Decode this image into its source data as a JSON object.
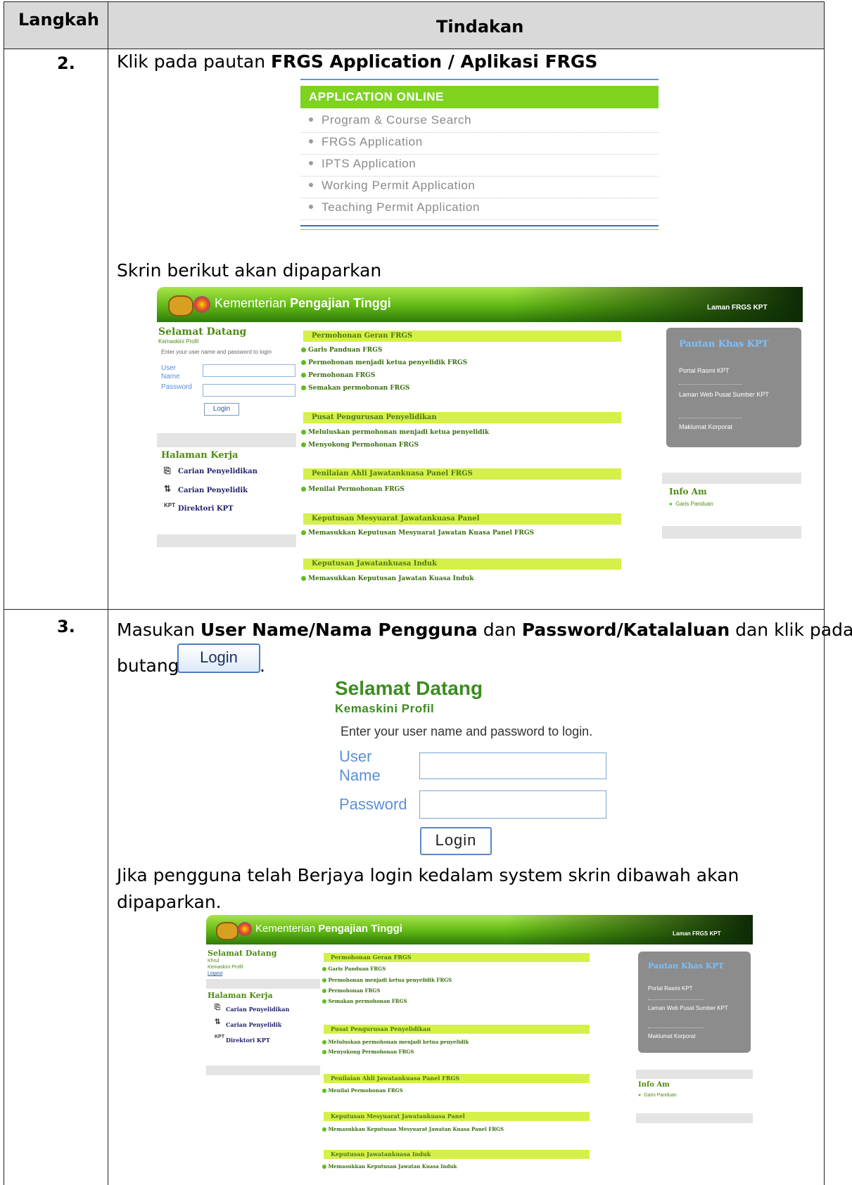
{
  "table": {
    "col_step": "Langkah",
    "col_action": "Tindakan"
  },
  "step2": {
    "number": "2.",
    "instruction_prefix": "Klik pada pautan ",
    "instruction_link": "FRGS Application / Aplikasi FRGS",
    "app_menu": {
      "header": "APPLICATION ONLINE",
      "items": [
        "Program & Course Search",
        "FRGS Application",
        "IPTS Application",
        "Working Permit Application",
        "Teaching Permit Application"
      ]
    },
    "caption": "Skrin berikut akan dipaparkan"
  },
  "portal1": {
    "title_light": "Kementerian ",
    "title_bold": "Pengajian Tinggi",
    "top_links": "Laman FRGS   KPT",
    "welcome": "Selamat Datang",
    "profile": "Kemaskini Profil",
    "hint": "Enter your user name and password to login",
    "user_label": "User Name",
    "password_label": "Password",
    "login_button": "Login",
    "work_title": "Halaman Kerja",
    "nav": [
      "Carian Penyelidikan",
      "Carian Penyelidik",
      "Direktori KPT"
    ],
    "sections": [
      {
        "title": "Permohonan Geran FRGS",
        "items": [
          "Garis Panduan FRGS",
          "Permohonan menjadi ketua penyelidik FRGS",
          "Permohonan FRGS",
          "Semakan permohonan FRGS"
        ]
      },
      {
        "title": "Pusat Pengurusan Penyelidikan",
        "items": [
          "Meluluskan permohonan menjadi ketua penyelidik",
          "Menyokong Permohonan FRGS"
        ]
      },
      {
        "title": "Penilaian Ahli Jawatankuasa Panel FRGS",
        "items": [
          "Menilai Permohonan FRGS"
        ]
      },
      {
        "title": "Keputusan Mesyuarat Jawatankuasa Panel",
        "items": [
          "Memasukkan Keputusan Mesyuarat Jawatan Kuasa Panel FRGS"
        ]
      },
      {
        "title": "Keputusan Jawatankuasa Induk",
        "items": [
          "Memasukkan Keputusan Jawatan Kuasa Induk"
        ]
      }
    ],
    "khas_title": "Pautan Khas KPT",
    "khas_links": [
      "Portal Rasmi KPT",
      "Laman Web Pusat Sumber KPT",
      "Maklumat Korporat"
    ],
    "info_title": "Info Am",
    "info_item": "Garis Panduan"
  },
  "step3": {
    "number": "3.",
    "line1_a": "Masukan ",
    "line1_b": "User Name/Nama Pengguna",
    "line1_c": " dan ",
    "line1_d": "Password/Katalaluan",
    "line1_e": " dan klik pada",
    "line2_a": "butang",
    "line2_b": ".",
    "inline_button": "Login",
    "login": {
      "title": "Selamat Datang",
      "subtitle": "Kemaskini Profil",
      "hint": "Enter your user name and password to login.",
      "user_line1": "User",
      "user_line2": "Name",
      "password_label": "Password",
      "button": "Login"
    },
    "after_line1": "Jika pengguna telah Berjaya login kedalam system skrin dibawah akan",
    "after_line2": "dipaparkan."
  },
  "portal2": {
    "title_light": "Kementerian ",
    "title_bold": "Pengajian Tinggi",
    "top_links": "Laman FRGS   KPT",
    "welcome": "Selamat Datang",
    "user": "Khrul",
    "profile": "Kemaskini Profil",
    "logout": "Logout",
    "work_title": "Halaman Kerja",
    "nav": [
      "Carian Penyelidikan",
      "Carian Penyelidik",
      "Direktori KPT"
    ],
    "sections": [
      {
        "title": "Permohonan Geran FRGS",
        "items": [
          "Garis Panduan FRGS",
          "Permohonan menjadi ketua penyelidik FRGS",
          "Permohonan FRGS",
          "Semakan permohonan FRGS"
        ]
      },
      {
        "title": "Pusat Pengurusan Penyelidikan",
        "items": [
          "Meluluskan permohonan menjadi ketua penyelidik",
          "Menyokong Permohonan FRGS"
        ]
      },
      {
        "title": "Penilaian Ahli Jawatankuasa Panel FRGS",
        "items": [
          "Menilai Permohonan FRGS"
        ]
      },
      {
        "title": "Keputusan Mesyuarat Jawatankuasa Panel",
        "items": [
          "Memasukkan Keputusan Mesyuarat Jawatan Kuasa Panel FRGS"
        ]
      },
      {
        "title": "Keputusan Jawatankuasa Induk",
        "items": [
          "Memasukkan Keputusan Jawatan Kuasa Induk"
        ]
      }
    ],
    "khas_title": "Pautan Khas KPT",
    "khas_links": [
      "Portal Rasmi KPT",
      "Laman Web Pusat Sumber KPT",
      "Maklumat Korporat"
    ],
    "info_title": "Info Am",
    "info_item": "Garis Panduan"
  },
  "colors": {
    "header_bg": "#d9d9d9",
    "menu_green": "#7ed321",
    "section_bar": "#d6f04a",
    "khas_gray": "#8c8c8c",
    "login_green": "#3c8c20",
    "label_blue": "#5b8fd8"
  }
}
